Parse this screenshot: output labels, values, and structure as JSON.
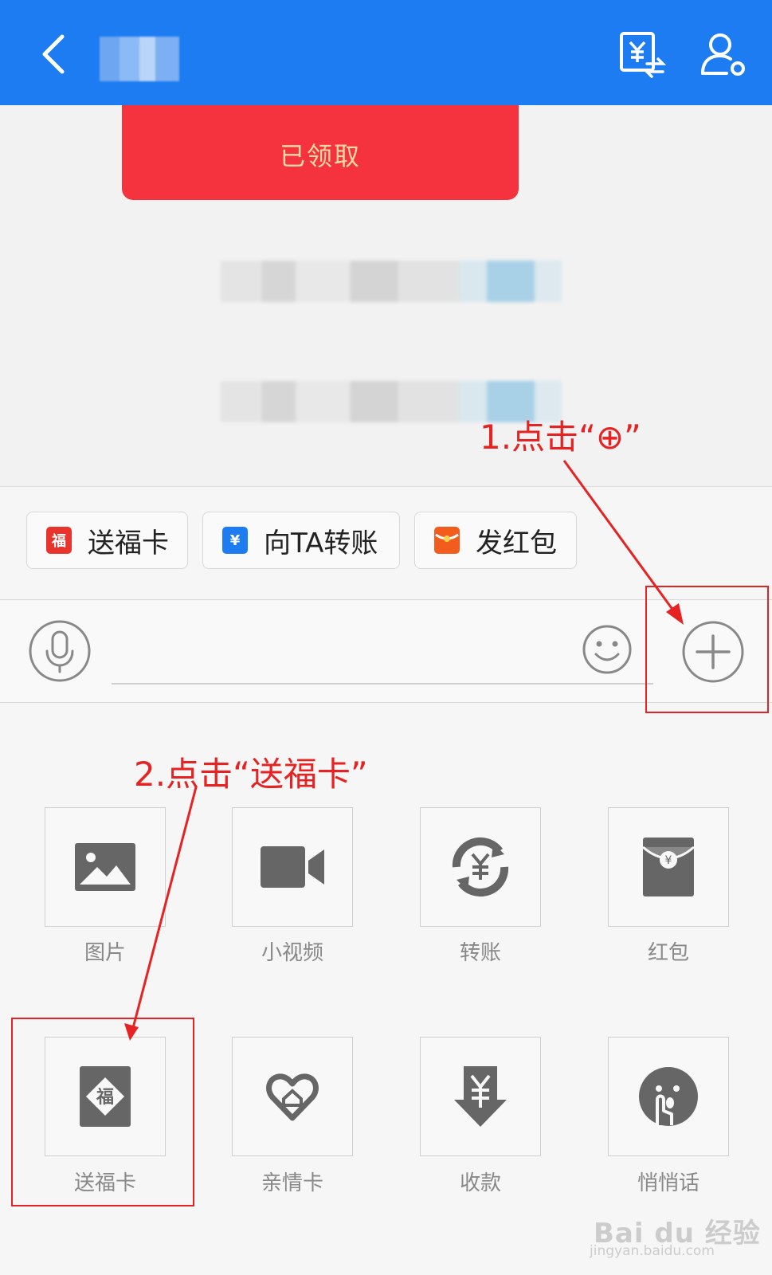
{
  "header": {
    "back_icon": "chevron-left-icon",
    "transfer_icon": "yuan-transfer-icon",
    "profile_icon": "user-settings-icon",
    "bg_color": "#1d7cf2"
  },
  "chat": {
    "red_packet_status": "已领取",
    "red_packet_color": "#f5333f"
  },
  "quick_actions": [
    {
      "label": "送福卡",
      "icon": "fu-card-icon",
      "color": "#e8342c"
    },
    {
      "label": "向TA转账",
      "icon": "yuan-icon",
      "color": "#1d7cf2"
    },
    {
      "label": "发红包",
      "icon": "red-envelope-icon",
      "color": "#f25c1c"
    }
  ],
  "input_bar": {
    "voice_icon": "microphone-icon",
    "emoji_icon": "smiley-icon",
    "plus_icon": "plus-circle-icon"
  },
  "panel_items": [
    {
      "label": "图片",
      "icon": "image-icon"
    },
    {
      "label": "小视频",
      "icon": "video-camera-icon"
    },
    {
      "label": "转账",
      "icon": "transfer-yuan-icon"
    },
    {
      "label": "红包",
      "icon": "red-packet-icon"
    },
    {
      "label": "送福卡",
      "icon": "fu-card-icon"
    },
    {
      "label": "亲情卡",
      "icon": "heart-home-icon"
    },
    {
      "label": "收款",
      "icon": "receive-yuan-icon"
    },
    {
      "label": "悄悄话",
      "icon": "whisper-icon"
    }
  ],
  "annotations": {
    "step1": "1.点击“⊕”",
    "step2": "2.点击“送福卡”",
    "color": "#e62222"
  },
  "watermark": {
    "brand": "Bai du 经验",
    "url": "jingyan.baidu.com"
  }
}
